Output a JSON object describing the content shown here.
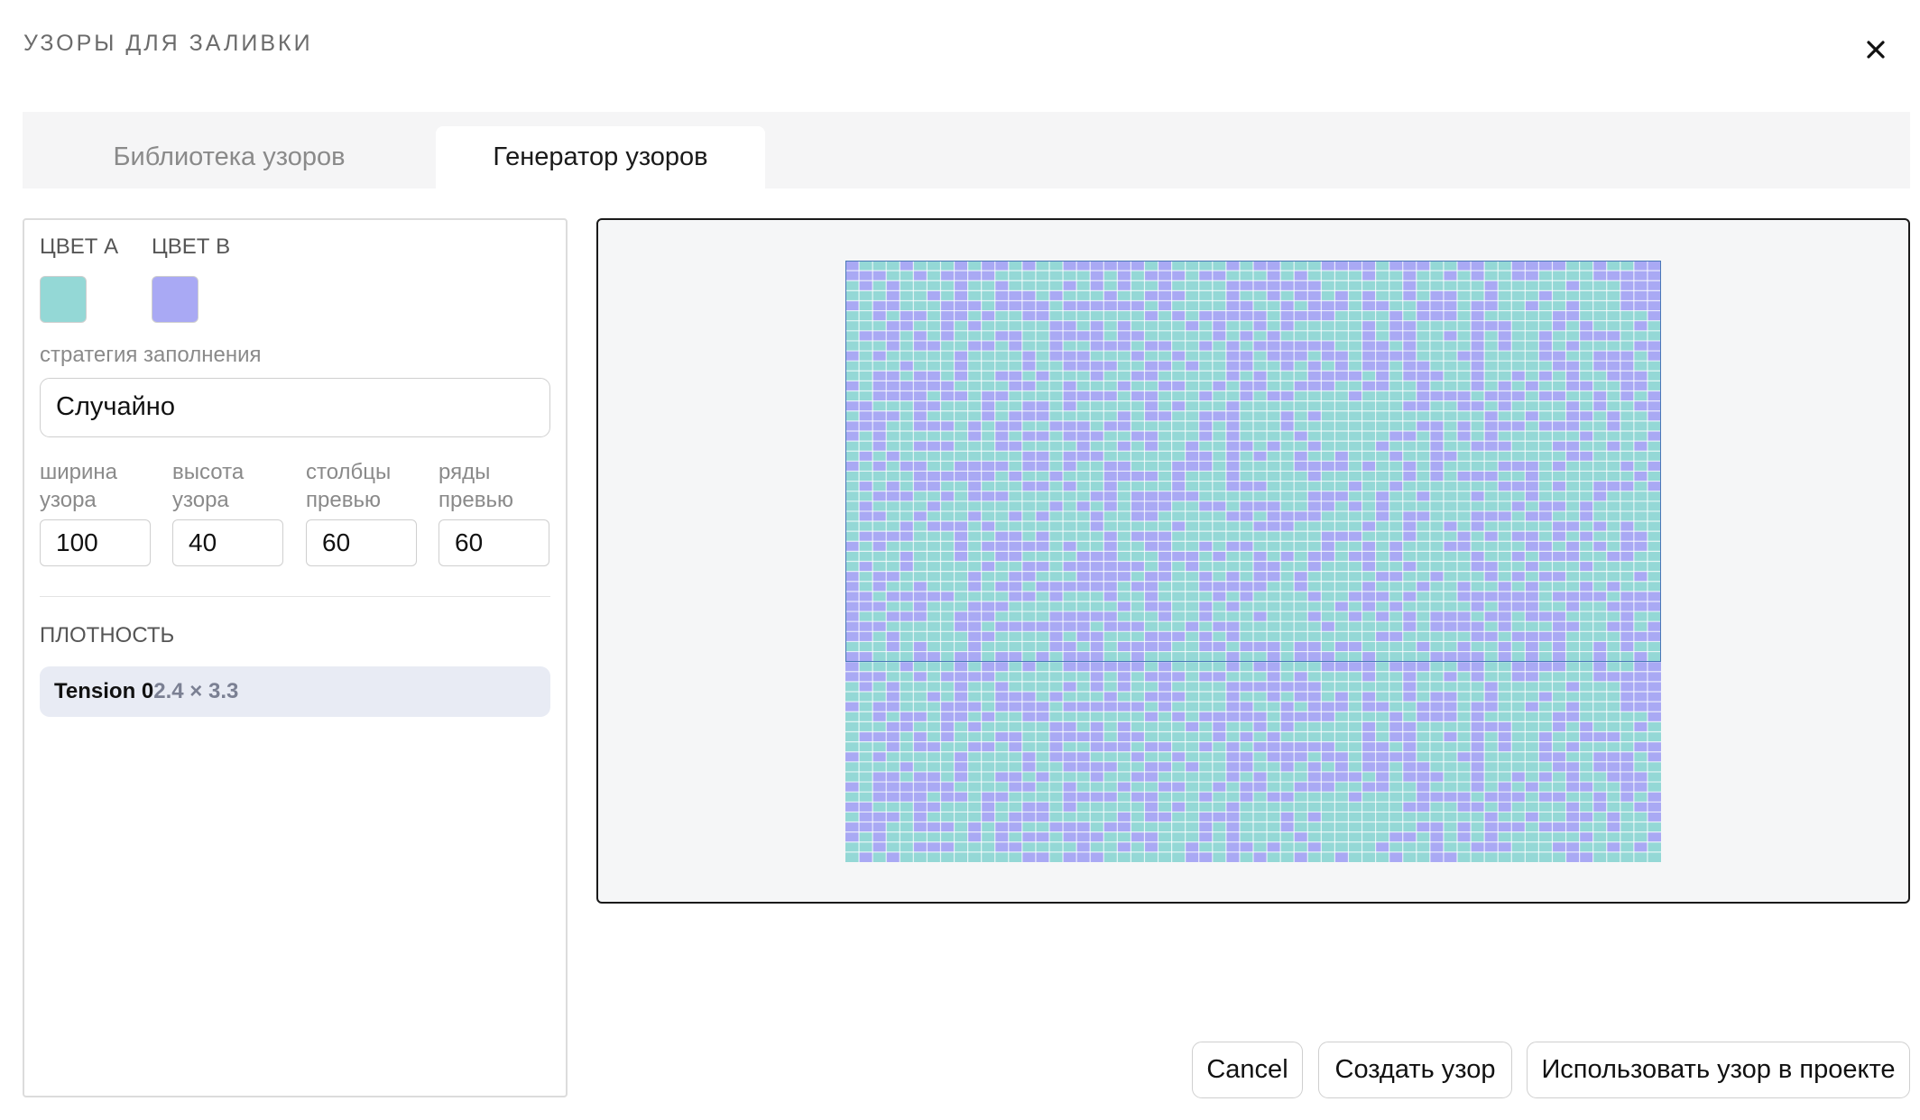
{
  "dialog": {
    "title": "УЗОРЫ ДЛЯ ЗАЛИВКИ"
  },
  "tabs": [
    {
      "label": "Библиотека узоров",
      "active": false
    },
    {
      "label": "Генератор узоров",
      "active": true
    }
  ],
  "settings": {
    "color_a": {
      "label": "ЦВЕТ A",
      "value": "#94d8d6"
    },
    "color_b": {
      "label": "ЦВЕТ B",
      "value": "#a9a9f4"
    },
    "fill_strategy": {
      "label": "стратегия заполнения",
      "value": "Случайно"
    },
    "fields": [
      {
        "line1": "ширина",
        "line2": "узора",
        "value": "100"
      },
      {
        "line1": "высота",
        "line2": "узора",
        "value": "40"
      },
      {
        "line1": "столбцы",
        "line2": "превью",
        "value": "60"
      },
      {
        "line1": "ряды",
        "line2": "превью",
        "value": "60"
      }
    ],
    "density": {
      "label": "ПЛОТНОСТЬ",
      "chip_name": "Tension 0",
      "chip_size": "2.4 × 3.3"
    }
  },
  "preview": {
    "columns": 60,
    "rows": 60,
    "tile_rows": 40,
    "cell_color_a": "#94d8d6",
    "cell_color_b": "#a9a9f4",
    "grid_line_color": "#ffffff",
    "tile_outline_color": "#4a78b8"
  },
  "footer": {
    "cancel_label": "Cancel",
    "create_label": "Создать узор",
    "use_label": "Использовать узор в проекте"
  }
}
